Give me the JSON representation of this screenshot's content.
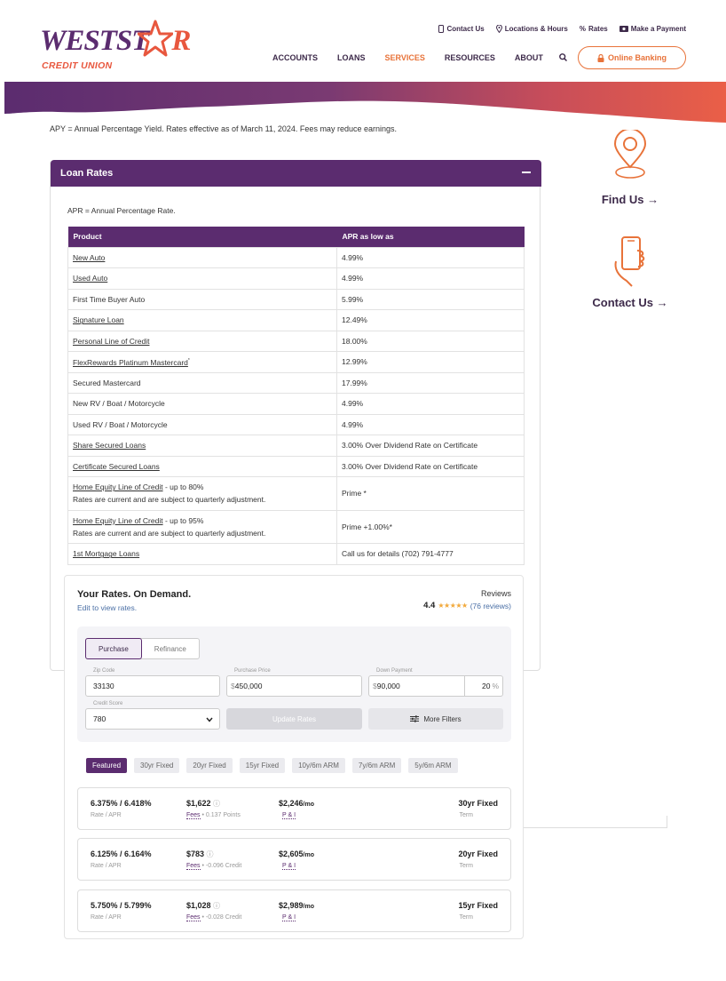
{
  "brand": {
    "logo_text_1": "WESTST",
    "logo_text_2": "R",
    "logo_sub": "CREDIT UNION",
    "purple": "#5b2c6f",
    "orange": "#e8733a"
  },
  "util_nav": [
    {
      "icon": "phone-icon",
      "label": "Contact Us"
    },
    {
      "icon": "location-pin-icon",
      "label": "Locations & Hours"
    },
    {
      "icon": "percent-icon",
      "label": "Rates"
    },
    {
      "icon": "payment-card-icon",
      "label": "Make a Payment"
    }
  ],
  "main_nav": [
    "ACCOUNTS",
    "LOANS",
    "SERVICES",
    "RESOURCES",
    "ABOUT"
  ],
  "main_nav_active": "SERVICES",
  "online_banking_label": "Online Banking",
  "apy_note": "APY = Annual Percentage Yield. Rates effective as of March 11, 2024. Fees may reduce earnings.",
  "loan_rates": {
    "title": "Loan Rates",
    "apr_note": "APR = Annual Percentage Rate.",
    "headers": [
      "Product",
      "APR as low as"
    ],
    "rows": [
      {
        "product": "New Auto",
        "link": true,
        "rate": "4.99%"
      },
      {
        "product": "Used Auto",
        "link": true,
        "rate": "4.99%"
      },
      {
        "product": "First Time Buyer Auto",
        "link": false,
        "rate": "5.99%"
      },
      {
        "product": "Signature Loan",
        "link": true,
        "rate": "12.49%"
      },
      {
        "product": "Personal Line of Credit",
        "link": true,
        "rate": "18.00%"
      },
      {
        "product": "FlexRewards Platinum Mastercard",
        "sup": "*",
        "link": true,
        "rate": "12.99%"
      },
      {
        "product": "Secured Mastercard",
        "link": false,
        "rate": "17.99%"
      },
      {
        "product": "New RV / Boat / Motorcycle",
        "link": false,
        "rate": "4.99%"
      },
      {
        "product": "Used RV / Boat / Motorcycle",
        "link": false,
        "rate": "4.99%"
      },
      {
        "product": "Share Secured Loans",
        "link": true,
        "rate": "3.00% Over Dividend Rate on Certificate"
      },
      {
        "product": "Certificate Secured Loans",
        "link": true,
        "rate": "3.00% Over Dividend Rate on Certificate"
      },
      {
        "product": "Home Equity Line of Credit",
        "suffix": " - up to 80%",
        "note": "Rates are current and are subject to quarterly adjustment.",
        "link": true,
        "rate": "Prime *"
      },
      {
        "product": "Home Equity Line of Credit",
        "suffix": " - up to 95%",
        "note": "Rates are current and are subject to quarterly adjustment.",
        "link": true,
        "rate": "Prime +1.00%*"
      },
      {
        "product": "1st Mortgage Loans",
        "link": true,
        "rate": "Call us for details (702) 791-4777"
      }
    ]
  },
  "sidebar": {
    "find_us": "Find Us",
    "contact_us": "Contact Us",
    "arrow": "→"
  },
  "widget": {
    "title": "Your Rates. On Demand.",
    "edit": "Edit to view rates.",
    "reviews_label": "Reviews",
    "rating": "4.4",
    "stars": "★★★★★",
    "reviews_count": "(76 reviews)",
    "seg_purchase": "Purchase",
    "seg_refinance": "Refinance",
    "zip_label": "Zip Code",
    "zip_value": "33130",
    "price_label": "Purchase Price",
    "price_prefix": "$",
    "price_value": "450,000",
    "down_label": "Down Payment",
    "down_prefix": "$",
    "down_value": "90,000",
    "down_pct": "20",
    "pct_sign": "%",
    "credit_label": "Credit Score",
    "credit_value": "780",
    "update_btn": "Update Rates",
    "more_filters": "More Filters",
    "tabs": [
      "Featured",
      "30yr Fixed",
      "20yr Fixed",
      "15yr Fixed",
      "10y/6m ARM",
      "7y/6m ARM",
      "5y/6m ARM"
    ],
    "active_tab": "Featured",
    "offers": [
      {
        "rate": "6.375% / 6.418%",
        "rate_sub": "Rate / APR",
        "fees": "$1,622",
        "fees_label": "Fees",
        "fees_note": " • 0.137 Points",
        "payment": "$2,246",
        "per": "/mo",
        "payment_sub": "P & I",
        "term": "30yr Fixed",
        "term_sub": "Term"
      },
      {
        "rate": "6.125% / 6.164%",
        "rate_sub": "Rate / APR",
        "fees": "$783",
        "fees_label": "Fees",
        "fees_note": " • -0.096 Credit",
        "payment": "$2,605",
        "per": "/mo",
        "payment_sub": "P & I",
        "term": "20yr Fixed",
        "term_sub": "Term"
      },
      {
        "rate": "5.750% / 5.799%",
        "rate_sub": "Rate / APR",
        "fees": "$1,028",
        "fees_label": "Fees",
        "fees_note": " • -0.028 Credit",
        "payment": "$2,989",
        "per": "/mo",
        "payment_sub": "P & I",
        "term": "15yr Fixed",
        "term_sub": "Term"
      }
    ]
  }
}
